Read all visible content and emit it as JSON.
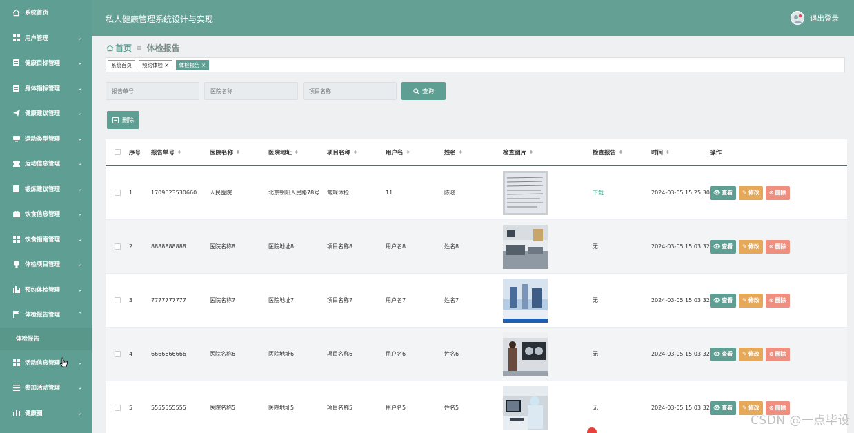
{
  "header": {
    "title": "私人健康管理系统设计与实现",
    "logout": "退出登录"
  },
  "sidebar": {
    "items": [
      {
        "label": "系统首页",
        "icon": "home-icon",
        "chev": ""
      },
      {
        "label": "用户管理",
        "icon": "grid-icon",
        "chev": "⌄"
      },
      {
        "label": "健康目标管理",
        "icon": "doc-icon",
        "chev": "⌄"
      },
      {
        "label": "身体指标管理",
        "icon": "doc-icon",
        "chev": "⌄"
      },
      {
        "label": "健康建议管理",
        "icon": "send-icon",
        "chev": "⌄"
      },
      {
        "label": "运动类型管理",
        "icon": "monitor-icon",
        "chev": "⌄"
      },
      {
        "label": "运动信息管理",
        "icon": "ticket-icon",
        "chev": "⌄"
      },
      {
        "label": "锻炼建议管理",
        "icon": "doc-icon",
        "chev": "⌄"
      },
      {
        "label": "饮食信息管理",
        "icon": "briefcase-icon",
        "chev": "⌄"
      },
      {
        "label": "饮食指南管理",
        "icon": "grid-icon",
        "chev": "⌄"
      },
      {
        "label": "体检项目管理",
        "icon": "bulb-icon",
        "chev": "⌄"
      },
      {
        "label": "预约体检管理",
        "icon": "chart-icon",
        "chev": "⌄"
      },
      {
        "label": "体检报告管理",
        "icon": "flag-icon",
        "chev": "⌃"
      }
    ],
    "sub_item": "体检报告",
    "items_after": [
      {
        "label": "活动信息管理",
        "icon": "grid-icon",
        "chev": "⌄"
      },
      {
        "label": "参加活动管理",
        "icon": "list-icon",
        "chev": "⌄"
      },
      {
        "label": "健康圈",
        "icon": "bar-icon",
        "chev": "⌄"
      }
    ]
  },
  "breadcrumb": {
    "home": "首页",
    "sep": "≡",
    "current": "体检报告"
  },
  "tags": [
    "系统首页",
    "预约体检 ×",
    "体检报告 ×"
  ],
  "search": {
    "report_no_placeholder": "报告单号",
    "hospital_placeholder": "医院名称",
    "item_placeholder": "项目名称",
    "search_label": "查询"
  },
  "toolbar": {
    "delete_label": "删除"
  },
  "table": {
    "headers": {
      "no": "序号",
      "report_no": "报告单号",
      "hospital": "医院名称",
      "address": "医院地址",
      "item": "项目名称",
      "username": "用户名",
      "name": "姓名",
      "image": "检查图片",
      "report": "检查报告",
      "time": "时间",
      "ops": "操作"
    },
    "rows": [
      {
        "no": "1",
        "report_no": "1709623530660",
        "hospital": "人民医院",
        "address": "北京朝阳人民路78号",
        "item": "常规体检",
        "username": "11",
        "name": "陈晓",
        "report": "下载",
        "time": "2024-03-05 15:25:30"
      },
      {
        "no": "2",
        "report_no": "8888888888",
        "hospital": "医院名称8",
        "address": "医院地址8",
        "item": "项目名称8",
        "username": "用户名8",
        "name": "姓名8",
        "report": "无",
        "time": "2024-03-05 15:03:32"
      },
      {
        "no": "3",
        "report_no": "7777777777",
        "hospital": "医院名称7",
        "address": "医院地址7",
        "item": "项目名称7",
        "username": "用户名7",
        "name": "姓名7",
        "report": "无",
        "time": "2024-03-05 15:03:32"
      },
      {
        "no": "4",
        "report_no": "6666666666",
        "hospital": "医院名称6",
        "address": "医院地址6",
        "item": "项目名称6",
        "username": "用户名6",
        "name": "姓名6",
        "report": "无",
        "time": "2024-03-05 15:03:32"
      },
      {
        "no": "5",
        "report_no": "5555555555",
        "hospital": "医院名称5",
        "address": "医院地址5",
        "item": "项目名称5",
        "username": "用户名5",
        "name": "姓名5",
        "report": "无",
        "time": "2024-03-05 15:03:32"
      }
    ],
    "ops": {
      "view": "查看",
      "edit": "修改",
      "delete": "删除"
    }
  },
  "watermark": "CSDN @一点毕设"
}
